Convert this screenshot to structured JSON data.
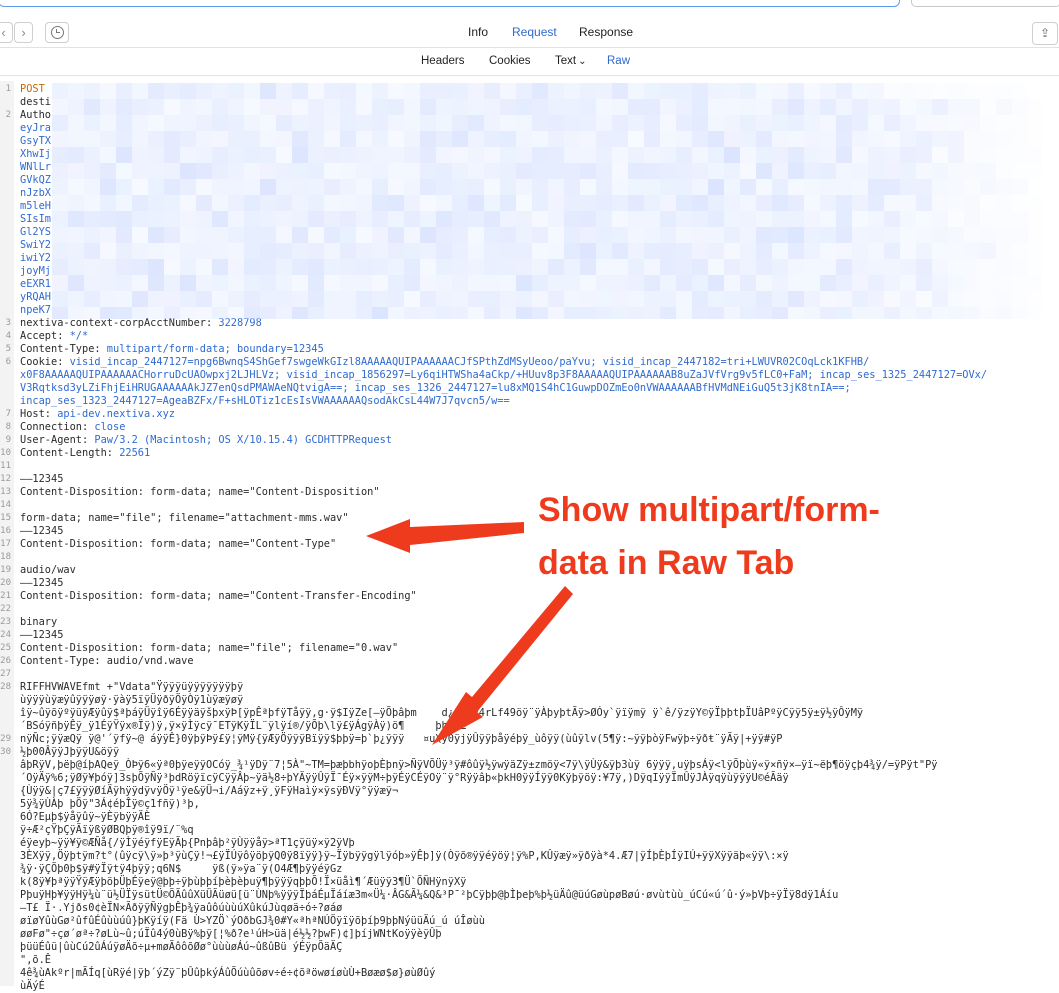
{
  "tabs": {
    "info": "Info",
    "request": "Request",
    "response": "Response"
  },
  "subtabs": {
    "headers": "Headers",
    "cookies": "Cookies",
    "text": "Text",
    "raw": "Raw"
  },
  "nav": {
    "back_glyph": "‹",
    "forward_glyph": "›",
    "share_glyph": "⇪"
  },
  "icons": {
    "history": "clock-icon",
    "share": "share-icon",
    "chevron": "chevron-down-icon"
  },
  "chevron_glyph": "⌄",
  "colors": {
    "accent": "#2f6ad0",
    "keyword": "#c56a00",
    "annotation": "#ef3b1d"
  },
  "callout_text": "Show multipart/form-data in Raw Tab",
  "raw_lines": [
    {
      "n": "1",
      "segs": [
        {
          "t": "POST",
          "c": "kw"
        }
      ]
    },
    {
      "n": "",
      "segs": [
        {
          "t": "desti"
        }
      ]
    },
    {
      "n": "2",
      "segs": [
        {
          "t": "Autho"
        }
      ]
    },
    {
      "n": "",
      "segs": [
        {
          "t": "eyJra",
          "c": "val"
        }
      ]
    },
    {
      "n": "",
      "segs": [
        {
          "t": "GsyTX",
          "c": "val"
        }
      ]
    },
    {
      "n": "",
      "segs": [
        {
          "t": "XhwIj",
          "c": "val"
        }
      ]
    },
    {
      "n": "",
      "segs": [
        {
          "t": "WNlLr",
          "c": "val"
        }
      ]
    },
    {
      "n": "",
      "segs": [
        {
          "t": "GVkQZ",
          "c": "val"
        }
      ]
    },
    {
      "n": "",
      "segs": [
        {
          "t": "nJzbX",
          "c": "val"
        }
      ]
    },
    {
      "n": "",
      "segs": [
        {
          "t": "m5leH",
          "c": "val"
        }
      ]
    },
    {
      "n": "",
      "segs": [
        {
          "t": "SIsIm",
          "c": "val"
        }
      ]
    },
    {
      "n": "",
      "segs": [
        {
          "t": "Gl2YS",
          "c": "val"
        }
      ]
    },
    {
      "n": "",
      "segs": [
        {
          "t": "SwiY2",
          "c": "val"
        }
      ]
    },
    {
      "n": "",
      "segs": [
        {
          "t": "iwiY2",
          "c": "val"
        }
      ]
    },
    {
      "n": "",
      "segs": [
        {
          "t": "joyMj",
          "c": "val"
        }
      ]
    },
    {
      "n": "",
      "segs": [
        {
          "t": "eEXR1",
          "c": "val"
        }
      ]
    },
    {
      "n": "",
      "segs": [
        {
          "t": "yRQAH",
          "c": "val"
        }
      ]
    },
    {
      "n": "",
      "segs": [
        {
          "t": "npeK7",
          "c": "val"
        }
      ]
    },
    {
      "n": "3",
      "segs": [
        {
          "t": "nextiva-context-corpAcctNumber: "
        },
        {
          "t": "3228798",
          "c": "val"
        }
      ]
    },
    {
      "n": "4",
      "segs": [
        {
          "t": "Accept: "
        },
        {
          "t": "*/*",
          "c": "val"
        }
      ]
    },
    {
      "n": "5",
      "segs": [
        {
          "t": "Content-Type: "
        },
        {
          "t": "multipart/form-data; boundary=12345",
          "c": "val"
        }
      ]
    },
    {
      "n": "6",
      "segs": [
        {
          "t": "Cookie: "
        },
        {
          "t": "visid_incap_2447127=npg6BwnqS4ShGef7swgeWkGIzl8AAAAAQUIPAAAAAACJfSPthZdMSyUeoo/paYvu; visid_incap_2447182=tri+LWUVR02COqLck1KFHB/",
          "c": "val"
        }
      ]
    },
    {
      "n": "",
      "segs": [
        {
          "t": "x0F8AAAAAQUIPAAAAAACHorruDcUAOwpxj2LJHLVz; visid_incap_1856297=Ly6qiHTWSha4aCkp/+HUuv8p3F8AAAAAQUIPAAAAAAB8uZaJVfVrg9v5fLC0+FaM; incap_ses_1325_2447127=OVx/",
          "c": "val"
        }
      ]
    },
    {
      "n": "",
      "segs": [
        {
          "t": "V3Rqtksd3yLZiFhjEiHRUGAAAAAAkJZ7enQsdPMAWAeNQtvigA==; incap_ses_1326_2447127=lu8xMQ1S4hC1GuwpDOZmEo0nVWAAAAAABfHVMdNEiGuQ5t3jK8tnIA==;",
          "c": "val"
        }
      ]
    },
    {
      "n": "",
      "segs": [
        {
          "t": "incap_ses_1323_2447127=AgeaBZFx/F+sHLOTiz1cEsIsVWAAAAAAQsodAkCsL44W7J7qvcn5/w==",
          "c": "val"
        }
      ]
    },
    {
      "n": "7",
      "segs": [
        {
          "t": "Host: "
        },
        {
          "t": "api-dev.nextiva.xyz",
          "c": "val"
        }
      ]
    },
    {
      "n": "8",
      "segs": [
        {
          "t": "Connection: "
        },
        {
          "t": "close",
          "c": "val"
        }
      ]
    },
    {
      "n": "9",
      "segs": [
        {
          "t": "User-Agent: "
        },
        {
          "t": "Paw/3.2 (Macintosh; OS X/10.15.4) GCDHTTPRequest",
          "c": "val"
        }
      ]
    },
    {
      "n": "10",
      "segs": [
        {
          "t": "Content-Length: "
        },
        {
          "t": "22561",
          "c": "val"
        }
      ]
    },
    {
      "n": "11",
      "segs": [
        {
          "t": ""
        }
      ]
    },
    {
      "n": "12",
      "segs": [
        {
          "t": "——12345"
        }
      ]
    },
    {
      "n": "13",
      "segs": [
        {
          "t": "Content-Disposition: form-data; name=\"Content-Disposition\""
        }
      ]
    },
    {
      "n": "14",
      "segs": [
        {
          "t": ""
        }
      ]
    },
    {
      "n": "15",
      "segs": [
        {
          "t": "form-data; name=\"file\"; filename=\"attachment-mms.wav\""
        }
      ]
    },
    {
      "n": "16",
      "segs": [
        {
          "t": "——12345"
        }
      ]
    },
    {
      "n": "17",
      "segs": [
        {
          "t": "Content-Disposition: form-data; name=\"Content-Type\""
        }
      ]
    },
    {
      "n": "18",
      "segs": [
        {
          "t": ""
        }
      ]
    },
    {
      "n": "19",
      "segs": [
        {
          "t": "audio/wav"
        }
      ]
    },
    {
      "n": "20",
      "segs": [
        {
          "t": "——12345"
        }
      ]
    },
    {
      "n": "21",
      "segs": [
        {
          "t": "Content-Disposition: form-data; name=\"Content-Transfer-Encoding\""
        }
      ]
    },
    {
      "n": "22",
      "segs": [
        {
          "t": ""
        }
      ]
    },
    {
      "n": "23",
      "segs": [
        {
          "t": "binary"
        }
      ]
    },
    {
      "n": "24",
      "segs": [
        {
          "t": "——12345"
        }
      ]
    },
    {
      "n": "25",
      "segs": [
        {
          "t": "Content-Disposition: form-data; name=\"file\"; filename=\"0.wav\""
        }
      ]
    },
    {
      "n": "26",
      "segs": [
        {
          "t": "Content-Type: audio/vnd.wave"
        }
      ]
    },
    {
      "n": "27",
      "segs": [
        {
          "t": ""
        }
      ]
    },
    {
      "n": "28",
      "segs": [
        {
          "t": "RIFFHVWAVEfmt +\"Vdata\"Ÿÿÿÿüÿÿÿÿÿÿÿþÿ"
        }
      ]
    },
    {
      "n": "",
      "segs": [
        {
          "t": "ùÿÿÿùÿæÿûÿÿÿøÿ·ÿàÿ5ïÿÜÿðÿÖÿÒÿ1ùÿæÿøÿ"
        }
      ]
    },
    {
      "n": "",
      "segs": [
        {
          "t": "îÿ~ûÿõÿºÿüÿÆÿûÿ$ªþáÿÜÿîÿ6ÉÿÿäÿšþxÿÞ[ÿpÊªþfÿTåÿÿ,g·ÿ$IÿZe[—ÿÕþâþm    d¿ÿ1ÿÿ4rLf49öÿ¨ÿÀþyþtÃÿ>ØÓy`ÿïÿmÿ ÿ`ê/ÿzÿY©ÿÏþþtþÏUâPºÿCÿÿ5ÿ±ÿ½ÿÔÿMÿ"
        }
      ]
    },
    {
      "n": "",
      "segs": [
        {
          "t": "´BSóÿñþÿÊÿ_ÿ1ÉÿŸÿx®Ïÿ)ÿ,ÿ×ÿÌÿcÿ¯ETÿKÿÏL¨ÿlÿí®/ÿÕþ\\lÿ£ÿÁgÿÀÿ)ö¶     þhÿfL"
        }
      ]
    },
    {
      "n": "29",
      "segs": [
        {
          "t": "nÿÑc;ÿÿæQÿ ÿ@'´ÿfÿ~@ áÿÿÊ}0ÿþÿÞÿ£ÿ¦ÿMÿ{ÿÆÿÖÿÿÿBïÿÿ$þþÿ=þ`þ¿ÿÿÿ   ¤u\\ÿ0ÿjÿÛÿÿþåÿéþÿ_ùôÿÿ(ùûÿlv(5¶ÿ:~ÿÿþòÿFwÿþ÷ÿðŧ¨ÿÃÿ|+ÿÿ#ÿP"
        }
      ]
    },
    {
      "n": "30",
      "segs": [
        {
          "t": "½þ00ÂÿÿJþÿÿU&öÿÿ"
        }
      ]
    },
    {
      "n": "",
      "segs": [
        {
          "t": "âþRÿV,þëþ@íþAQeÿ_ÒÞÿ6«ÿª0þÿeÿÿOCóÿ_¾¹ÿDÿ¨7¦5À\"~TM=þæþbhÿoþÈþnÿ>ÑÿVÕÜÿ³ÿ#ôûÿ½ÿwÿäZÿ±zmöÿ<7ÿ\\ÿÙÿ&ÿþ3ùÿ 6ÿÿÿ,uÿþsÁÿ<lÿÕþùÿ«ÿ×ñÿ×—ÿï~ëþ¶öÿçþ4¾ÿ/=ÿPÿt\"Pÿ"
        }
      ]
    },
    {
      "n": "",
      "segs": [
        {
          "t": "´OÿÄÿ%6;ÿØÿ¥þóÿ]3sþÕÿÑÿ³þdRöÿïcÿCÿÿÂþ~ÿä½8÷þYÄÿÿÛÿÏ¯Éÿ×ÿÿM÷þÿÉÿCÉÿOÿ¨ÿ°Rÿÿâþ«þkH0ÿÿÍÿÿ0Kÿþÿöÿ:¥7ÿ,)DÿqIÿÿÏmÛÿJÀÿqÿùÿÿÿU©éÃäÿ"
        }
      ]
    },
    {
      "n": "",
      "segs": [
        {
          "t": "{Ùÿÿ&|ç7£ÿÿÿØíÄÿhÿÿdÿvÿÖÿ¹ÿe&ÿÜ¬i/Aáÿz+ÿ¸ÿFÿHaìÿ×ÿsÿÐVÿ°ÿÿæÿ¬"
        }
      ]
    },
    {
      "n": "",
      "segs": [
        {
          "t": "5ÿ¾ÿÙÀþ þÖÿ\"3Á¢éþÎÿ©ç1fñÿ)³þ,"
        }
      ]
    },
    {
      "n": "",
      "segs": [
        {
          "t": "6Ó?Eµþ$ÿåÿûÿ~ÿÈÿbÿÿÄÈ"
        }
      ]
    },
    {
      "n": "",
      "segs": [
        {
          "t": "ÿ÷Æ²çŸþÇÿÃïÿßÿØBQþÿ®îÿ9ï/¨%q"
        }
      ]
    },
    {
      "n": "",
      "segs": [
        {
          "t": "éÿeyþ~ÿÿ¥ÿ©ÆÑå{/ÿÌÿéÿfÿEÿÃþ{Pnþâþ²ÿÙÿÿåÿ>ªT1çÿüÿ×ÿ2ÿVþ"
        }
      ]
    },
    {
      "n": "",
      "segs": [
        {
          "t": "3ÈXÿÿ,Öÿþtÿm?t°(ûÿcÿ\\ÿ»þ³ÿùÇÿ!¬£ÿÏÚÿôÿöþÿQ0ÿ8ïÿÿ}ÿ~Ïÿbÿÿgÿlÿóþ»ÿÊþ]ÿ(Òÿõ®ÿÿéÿöÿ¦ÿ%P,KÛÿæÿ»ÿðÿà*4.Æ7|ÿÍþÈþÍÿIÚ+ÿÿXÿÿäþ«ÿÿ\\:×ÿ"
        }
      ]
    },
    {
      "n": "",
      "segs": [
        {
          "t": "¾ÿ·ÿÇÕþ0þ$ÿ#ÿÏÿtÿ4þÿÿ;q6N$     ÿß(ÿ»ÿa¨ÿ(O4Æ¶þÿÿéÿGz"
        }
      ]
    },
    {
      "n": "",
      "segs": [
        {
          "t": "k(8ÿ¥þªÿÿŸÿÆÿþöþÜþÉÿeÿ@þþ÷ÿþùþþíþèþèþuÿ¶þÿÿÿqþþÕ!Ï×üåì¶´Æüÿÿ3¶Ü`ÕÑHÿnÿXÿ"
        }
      ]
    },
    {
      "n": "",
      "segs": [
        {
          "t": "PþuÿHþ¥ÿÿHÿ¼ù¨ü½ÜÏÿsütÜ©ÕÃûûXüÜÃüøü[ü¨ÙNþ%ÿÿÿÏþáÉµÏáíæ3m«Ü¼·ÂG&Ã¼&Q&³P¯²þCÿþþ@þÌþeþ%þ½üÄû@üúGøùpøBøú·øvùtùù_úCú«ú´û·ý»þVþ÷ÿÏÿ8dÿ1Áíu"
        }
      ]
    },
    {
      "n": "",
      "segs": [
        {
          "t": "—T£ Ï·.Yjðs0¢èÏN×ÃðÿÿÑÿgþÊþ¾ÿaûôúùùúXûkúJùqøä÷ó÷?øáø"
        }
      ]
    },
    {
      "n": "",
      "segs": [
        {
          "t": "øïøYûùGø²ûfûÉûùùúû}þKÿíÿ(Fä Ù>YZÖ`ýOðbGJ¾0#Y«ªhªNÚÖÿïÿõþíþ9þþNýüüÄú_ú úÎøùù"
        }
      ]
    },
    {
      "n": "",
      "segs": [
        {
          "t": "øøFø\"÷çø´øª÷?øLù~û;úÏû4ý0ùBÿ%þÿ[¦%ð?e¹úH>üä|é½½?þwF)¢]þíjWNtKoÿÿèÿÛþ"
        }
      ]
    },
    {
      "n": "",
      "segs": [
        {
          "t": "þüüÉûü|ûùCú2ûÁúÿøÄõ÷µ+møÃôôõØø°ùùùøÁú~ûßûBü ýÉÿpÕäÄÇ"
        }
      ]
    },
    {
      "n": "",
      "segs": [
        {
          "t": "\",õ.Ê"
        }
      ]
    },
    {
      "n": "",
      "segs": [
        {
          "t": "4ê¾ùAkºr|mÃÍq[ùRÿé|ÿþ´ýZÿ¨þÛûþkýÁûÕúùûõøv÷é÷¢õªöwøíøùÙ+Bøæø$ø}øùØûý"
        }
      ]
    },
    {
      "n": "",
      "segs": [
        {
          "t": "ùÄýÉ"
        }
      ]
    }
  ]
}
